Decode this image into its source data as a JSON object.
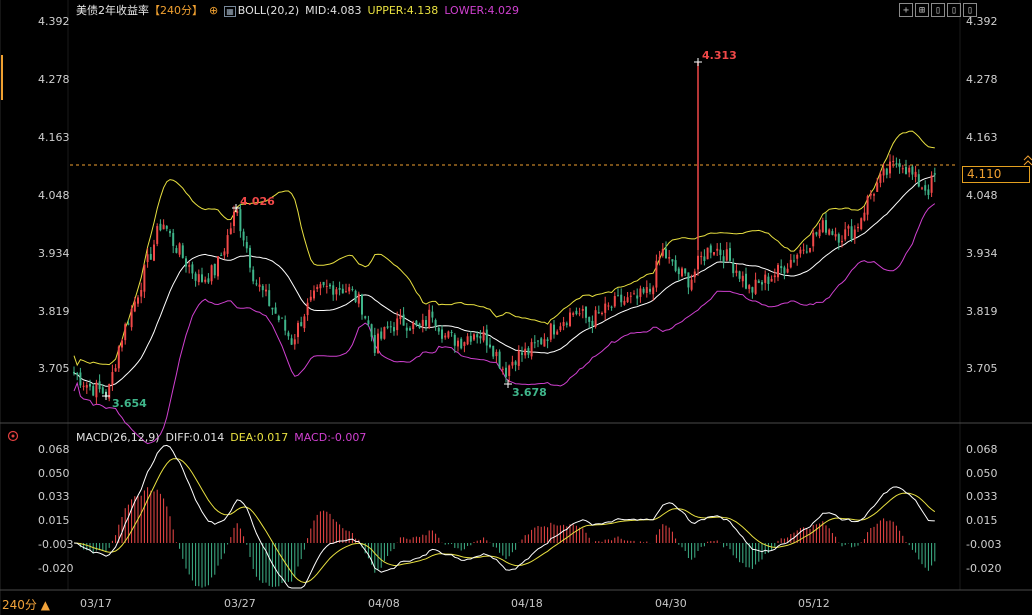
{
  "header": {
    "title": "美债2年收益率",
    "period_tag": "【240分】",
    "boll_label": "BOLL(20,2)",
    "mid": "MID:4.083",
    "upper": "UPPER:4.138",
    "lower": "LOWER:4.029"
  },
  "macd_header": {
    "label": "MACD(26,12,9)",
    "diff": "DIFF:0.014",
    "dea": "DEA:0.017",
    "macd": "MACD:-0.007"
  },
  "toolbar": {
    "b1": "+",
    "b2": "⊞",
    "b3": "▯",
    "b4": "▯",
    "b5": "▯"
  },
  "price_axis": [
    "4.392",
    "4.278",
    "4.163",
    "4.048",
    "3.934",
    "3.819",
    "3.705"
  ],
  "macd_axis": [
    "0.068",
    "0.050",
    "0.033",
    "0.015",
    "-0.003",
    "-0.020"
  ],
  "current_price": "4.110",
  "period_selector": "240分 ▲",
  "x_labels": [
    "03/17",
    "03/27",
    "04/08",
    "04/18",
    "04/30",
    "05/12"
  ],
  "annotations": {
    "low1": "3.654",
    "high1": "4.026",
    "low2": "3.678",
    "high2": "4.313"
  },
  "colors": {
    "up": "#f04848",
    "down": "#3fb58a",
    "upper": "#e8e040",
    "mid": "#ffffff",
    "lower": "#d040d0",
    "dea": "#e8e040",
    "diff": "#ffffff",
    "accent": "#f0a030"
  }
}
